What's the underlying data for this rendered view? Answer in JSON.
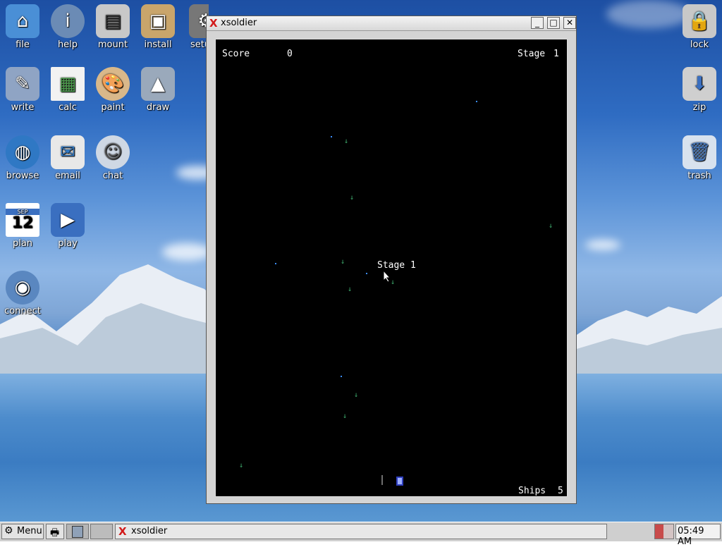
{
  "desktop": {
    "icons_left": [
      {
        "label": "file",
        "icon": "home-icon"
      },
      {
        "label": "help",
        "icon": "info-icon"
      },
      {
        "label": "mount",
        "icon": "drive-icon"
      },
      {
        "label": "install",
        "icon": "package-icon"
      },
      {
        "label": "setup",
        "icon": "settings-icon"
      },
      {
        "label": "write",
        "icon": "document-icon"
      },
      {
        "label": "calc",
        "icon": "spreadsheet-icon"
      },
      {
        "label": "paint",
        "icon": "palette-icon"
      },
      {
        "label": "draw",
        "icon": "shapes-icon"
      },
      {
        "label": "browse",
        "icon": "globe-icon"
      },
      {
        "label": "email",
        "icon": "envelope-icon"
      },
      {
        "label": "chat",
        "icon": "chat-bubble-icon"
      },
      {
        "label": "plan",
        "icon": "calendar-icon",
        "day": "12",
        "month": "SEP"
      },
      {
        "label": "play",
        "icon": "media-icon"
      },
      {
        "label": "connect",
        "icon": "network-globe-icon"
      }
    ],
    "icons_right": [
      {
        "label": "lock",
        "icon": "padlock-icon"
      },
      {
        "label": "zip",
        "icon": "archive-icon"
      },
      {
        "label": "trash",
        "icon": "trash-icon"
      }
    ]
  },
  "window": {
    "title": "xsoldier",
    "title_icon_glyph": "X",
    "minimize_glyph": "_",
    "maximize_glyph": "□",
    "close_glyph": "✕"
  },
  "game": {
    "score_label": "Score",
    "score_value": "0",
    "stage_label": "Stage",
    "stage_value": "1",
    "center_message": "Stage 1",
    "ships_label": "Ships",
    "ships_value": "5"
  },
  "taskbar": {
    "menu_label": "Menu",
    "task_label": "xsoldier",
    "task_glyph": "X",
    "clock": "05:49 AM"
  },
  "colors": {
    "window_title_icon": "#d21a1a",
    "game_background": "#000000",
    "star": "#3a8cff",
    "enemy_shot": "#3fae6f"
  }
}
